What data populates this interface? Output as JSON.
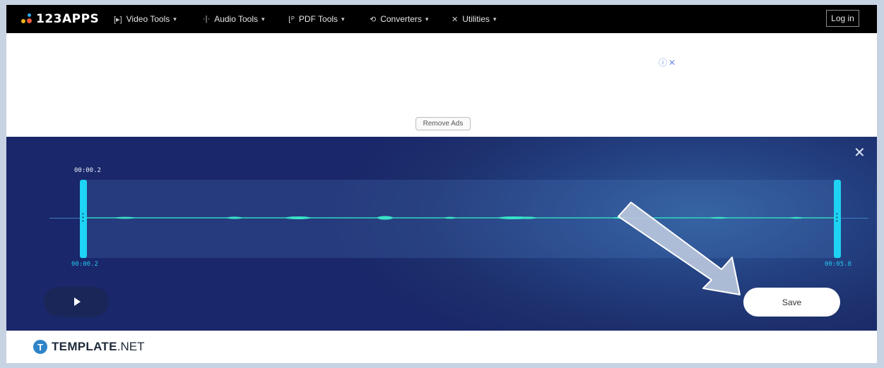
{
  "nav": {
    "logo": "123APPS",
    "items": [
      {
        "label": "Video Tools",
        "icon": "video-icon"
      },
      {
        "label": "Audio Tools",
        "icon": "audio-wave-icon"
      },
      {
        "label": "PDF Tools",
        "icon": "pdf-icon"
      },
      {
        "label": "Converters",
        "icon": "convert-icon"
      },
      {
        "label": "Utilities",
        "icon": "tools-icon"
      }
    ],
    "login": "Log in"
  },
  "ad": {
    "remove_ads": "Remove Ads",
    "icons": "ⓘ✕"
  },
  "editor": {
    "start_time_top": "00:00.2",
    "start_time_bottom": "00:00.2",
    "end_time_bottom": "00:05.8",
    "save_label": "Save",
    "close_symbol": "✕"
  },
  "footer": {
    "brand_bold": "TEMPLATE",
    "brand_light": ".NET",
    "brand_icon_letter": "T"
  },
  "colors": {
    "nav_bg": "#000000",
    "editor_bg": "#1d2f6c",
    "handle": "#1ed3f3",
    "waveform": "#2fd7c0",
    "brand_blue": "#2f84c8"
  }
}
